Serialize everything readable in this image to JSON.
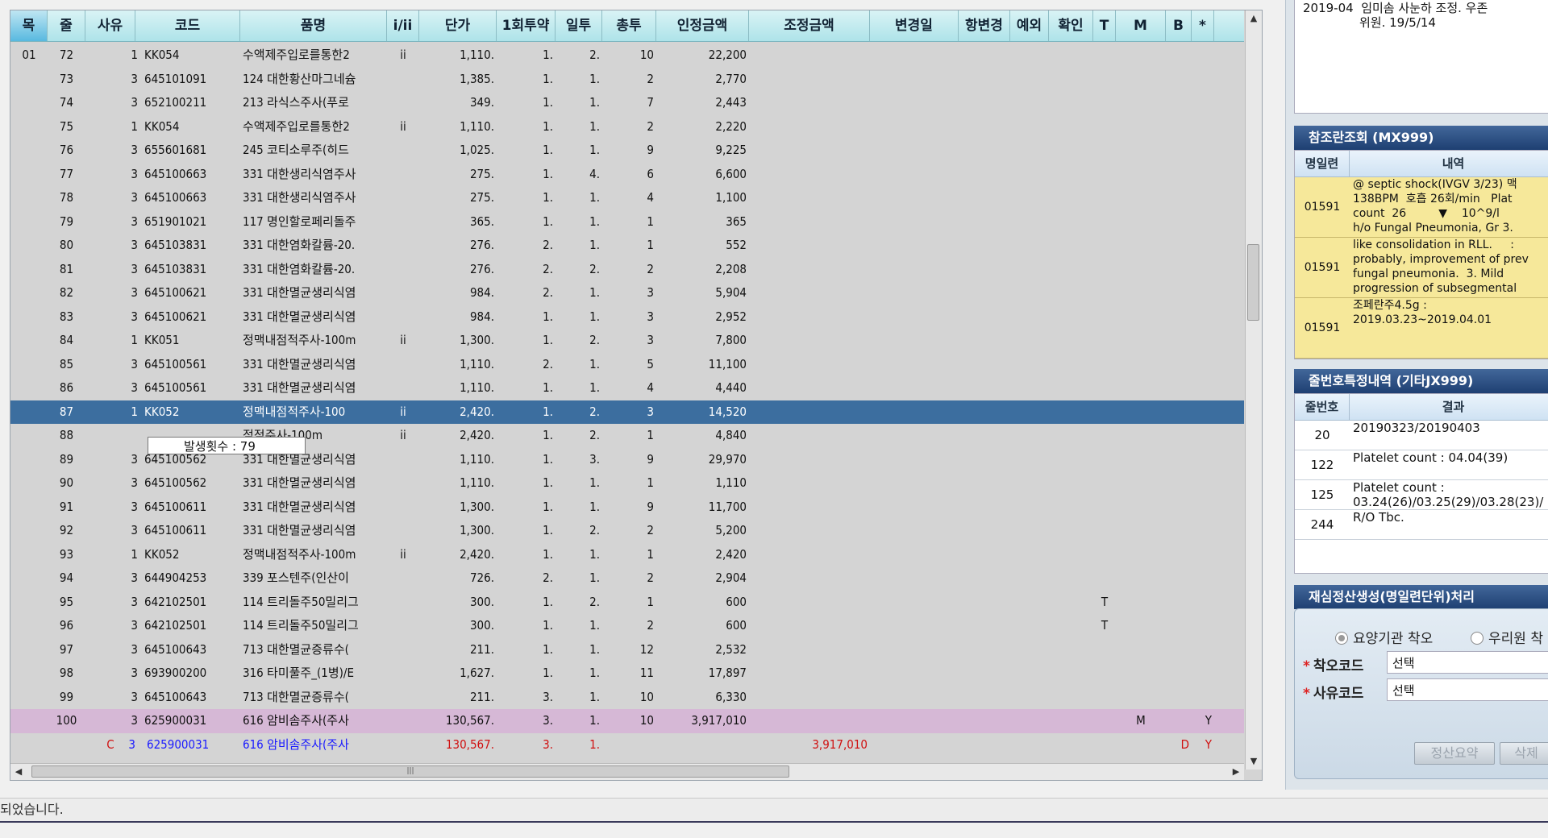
{
  "grid": {
    "columns": [
      {
        "key": "a",
        "label": "목",
        "w": 46
      },
      {
        "key": "b",
        "label": "줄",
        "w": 47
      },
      {
        "key": "c",
        "label": "사유",
        "w": 62
      },
      {
        "key": "d",
        "label": "코드",
        "w": 130
      },
      {
        "key": "e",
        "label": "품명",
        "w": 182
      },
      {
        "key": "f",
        "label": "i/ii",
        "w": 40
      },
      {
        "key": "g",
        "label": "단가",
        "w": 96
      },
      {
        "key": "h",
        "label": "1회투약",
        "w": 73
      },
      {
        "key": "i",
        "label": "일투",
        "w": 58
      },
      {
        "key": "j",
        "label": "총투",
        "w": 67
      },
      {
        "key": "k",
        "label": "인정금액",
        "w": 115
      },
      {
        "key": "l",
        "label": "조정금액",
        "w": 150
      },
      {
        "key": "m",
        "label": "변경일",
        "w": 110
      },
      {
        "key": "n",
        "label": "항변경",
        "w": 64
      },
      {
        "key": "o",
        "label": "예외",
        "w": 48
      },
      {
        "key": "p",
        "label": "확인",
        "w": 55
      },
      {
        "key": "q",
        "label": "T",
        "w": 28
      },
      {
        "key": "r",
        "label": "M",
        "w": 62
      },
      {
        "key": "s",
        "label": "B",
        "w": 32
      },
      {
        "key": "t",
        "label": "*",
        "w": 28
      }
    ],
    "rows": [
      {
        "a": "01",
        "b": "72",
        "c": "",
        "sub": "1",
        "d": "KK054",
        "e": "수액제주입로를통한2",
        "f": "ii",
        "g": "1,110.",
        "h": "1.",
        "i": "2.",
        "j": "10",
        "k": "22,200",
        "style": ""
      },
      {
        "a": "",
        "b": "73",
        "c": "",
        "sub": "3",
        "d": "645101091",
        "e": "124 대한황산마그네슘",
        "f": "",
        "g": "1,385.",
        "h": "1.",
        "i": "1.",
        "j": "2",
        "k": "2,770",
        "style": ""
      },
      {
        "a": "",
        "b": "74",
        "c": "",
        "sub": "3",
        "d": "652100211",
        "e": "213 라식스주사(푸로",
        "f": "",
        "g": "349.",
        "h": "1.",
        "i": "1.",
        "j": "7",
        "k": "2,443",
        "style": ""
      },
      {
        "a": "",
        "b": "75",
        "c": "",
        "sub": "1",
        "d": "KK054",
        "e": "수액제주입로를통한2",
        "f": "ii",
        "g": "1,110.",
        "h": "1.",
        "i": "1.",
        "j": "2",
        "k": "2,220",
        "style": ""
      },
      {
        "a": "",
        "b": "76",
        "c": "",
        "sub": "3",
        "d": "655601681",
        "e": "245 코티소루주(히드",
        "f": "",
        "g": "1,025.",
        "h": "1.",
        "i": "1.",
        "j": "9",
        "k": "9,225",
        "style": ""
      },
      {
        "a": "",
        "b": "77",
        "c": "",
        "sub": "3",
        "d": "645100663",
        "e": "331 대한생리식염주사",
        "f": "",
        "g": "275.",
        "h": "1.",
        "i": "4.",
        "j": "6",
        "k": "6,600",
        "style": ""
      },
      {
        "a": "",
        "b": "78",
        "c": "",
        "sub": "3",
        "d": "645100663",
        "e": "331 대한생리식염주사",
        "f": "",
        "g": "275.",
        "h": "1.",
        "i": "1.",
        "j": "4",
        "k": "1,100",
        "style": ""
      },
      {
        "a": "",
        "b": "79",
        "c": "",
        "sub": "3",
        "d": "651901021",
        "e": "117 명인할로페리돌주",
        "f": "",
        "g": "365.",
        "h": "1.",
        "i": "1.",
        "j": "1",
        "k": "365",
        "style": ""
      },
      {
        "a": "",
        "b": "80",
        "c": "",
        "sub": "3",
        "d": "645103831",
        "e": "331 대한염화칼륨-20.",
        "f": "",
        "g": "276.",
        "h": "2.",
        "i": "1.",
        "j": "1",
        "k": "552",
        "style": ""
      },
      {
        "a": "",
        "b": "81",
        "c": "",
        "sub": "3",
        "d": "645103831",
        "e": "331 대한염화칼륨-20.",
        "f": "",
        "g": "276.",
        "h": "2.",
        "i": "2.",
        "j": "2",
        "k": "2,208",
        "style": ""
      },
      {
        "a": "",
        "b": "82",
        "c": "",
        "sub": "3",
        "d": "645100621",
        "e": "331 대한멸균생리식염",
        "f": "",
        "g": "984.",
        "h": "2.",
        "i": "1.",
        "j": "3",
        "k": "5,904",
        "style": ""
      },
      {
        "a": "",
        "b": "83",
        "c": "",
        "sub": "3",
        "d": "645100621",
        "e": "331 대한멸균생리식염",
        "f": "",
        "g": "984.",
        "h": "1.",
        "i": "1.",
        "j": "3",
        "k": "2,952",
        "style": ""
      },
      {
        "a": "",
        "b": "84",
        "c": "",
        "sub": "1",
        "d": "KK051",
        "e": "정맥내점적주사-100m",
        "f": "ii",
        "g": "1,300.",
        "h": "1.",
        "i": "2.",
        "j": "3",
        "k": "7,800",
        "style": ""
      },
      {
        "a": "",
        "b": "85",
        "c": "",
        "sub": "3",
        "d": "645100561",
        "e": "331 대한멸균생리식염",
        "f": "",
        "g": "1,110.",
        "h": "2.",
        "i": "1.",
        "j": "5",
        "k": "11,100",
        "style": ""
      },
      {
        "a": "",
        "b": "86",
        "c": "",
        "sub": "3",
        "d": "645100561",
        "e": "331 대한멸균생리식염",
        "f": "",
        "g": "1,110.",
        "h": "1.",
        "i": "1.",
        "j": "4",
        "k": "4,440",
        "style": ""
      },
      {
        "a": "",
        "b": "87",
        "c": "",
        "sub": "1",
        "d": "KK052",
        "e": "정맥내점적주사-100",
        "f": "ii",
        "g": "2,420.",
        "h": "1.",
        "i": "2.",
        "j": "3",
        "k": "14,520",
        "style": "selected"
      },
      {
        "a": "",
        "b": "88",
        "c": "",
        "sub": "",
        "d": "",
        "e": "점적주사-100m",
        "f": "ii",
        "g": "2,420.",
        "h": "1.",
        "i": "2.",
        "j": "1",
        "k": "4,840",
        "style": ""
      },
      {
        "a": "",
        "b": "89",
        "c": "",
        "sub": "3",
        "d": "645100562",
        "e": "331 대한멸균생리식염",
        "f": "",
        "g": "1,110.",
        "h": "1.",
        "i": "3.",
        "j": "9",
        "k": "29,970",
        "style": ""
      },
      {
        "a": "",
        "b": "90",
        "c": "",
        "sub": "3",
        "d": "645100562",
        "e": "331 대한멸균생리식염",
        "f": "",
        "g": "1,110.",
        "h": "1.",
        "i": "1.",
        "j": "1",
        "k": "1,110",
        "style": ""
      },
      {
        "a": "",
        "b": "91",
        "c": "",
        "sub": "3",
        "d": "645100611",
        "e": "331 대한멸균생리식염",
        "f": "",
        "g": "1,300.",
        "h": "1.",
        "i": "1.",
        "j": "9",
        "k": "11,700",
        "style": ""
      },
      {
        "a": "",
        "b": "92",
        "c": "",
        "sub": "3",
        "d": "645100611",
        "e": "331 대한멸균생리식염",
        "f": "",
        "g": "1,300.",
        "h": "1.",
        "i": "2.",
        "j": "2",
        "k": "5,200",
        "style": ""
      },
      {
        "a": "",
        "b": "93",
        "c": "",
        "sub": "1",
        "d": "KK052",
        "e": "정맥내점적주사-100m",
        "f": "ii",
        "g": "2,420.",
        "h": "1.",
        "i": "1.",
        "j": "1",
        "k": "2,420",
        "style": ""
      },
      {
        "a": "",
        "b": "94",
        "c": "",
        "sub": "3",
        "d": "644904253",
        "e": "339 포스텐주(인산이",
        "f": "",
        "g": "726.",
        "h": "2.",
        "i": "1.",
        "j": "2",
        "k": "2,904",
        "style": ""
      },
      {
        "a": "",
        "b": "95",
        "c": "",
        "sub": "3",
        "d": "642102501",
        "e": "114 트리돌주50밀리그",
        "f": "",
        "g": "300.",
        "h": "1.",
        "i": "2.",
        "j": "1",
        "k": "600",
        "q": "T",
        "style": ""
      },
      {
        "a": "",
        "b": "96",
        "c": "",
        "sub": "3",
        "d": "642102501",
        "e": "114 트리돌주50밀리그",
        "f": "",
        "g": "300.",
        "h": "1.",
        "i": "1.",
        "j": "2",
        "k": "600",
        "q": "T",
        "style": ""
      },
      {
        "a": "",
        "b": "97",
        "c": "",
        "sub": "3",
        "d": "645100643",
        "e": "713 대한멸균증류수(",
        "f": "",
        "g": "211.",
        "h": "1.",
        "i": "1.",
        "j": "12",
        "k": "2,532",
        "style": ""
      },
      {
        "a": "",
        "b": "98",
        "c": "",
        "sub": "3",
        "d": "693900200",
        "e": "316 타미풀주_(1병)/E",
        "f": "",
        "g": "1,627.",
        "h": "1.",
        "i": "1.",
        "j": "11",
        "k": "17,897",
        "style": ""
      },
      {
        "a": "",
        "b": "99",
        "c": "",
        "sub": "3",
        "d": "645100643",
        "e": "713 대한멸균증류수(",
        "f": "",
        "g": "211.",
        "h": "3.",
        "i": "1.",
        "j": "10",
        "k": "6,330",
        "style": ""
      },
      {
        "a": "",
        "b": "100",
        "c": "",
        "sub": "3",
        "d": "625900031",
        "e": "616 암비솜주사(주사",
        "f": "",
        "g": "130,567.",
        "h": "3.",
        "i": "1.",
        "j": "10",
        "k": "3,917,010",
        "r": "M",
        "t": "Y",
        "style": "pink"
      },
      {
        "a": "",
        "b": "",
        "c": "C",
        "sub": "3",
        "d": "625900031",
        "e": "616 암비솜주사(주사",
        "f": "",
        "g": "130,567.",
        "h": "3.",
        "i": "1.",
        "j": "",
        "k": "",
        "l": "3,917,010",
        "s": "D",
        "t": "Y",
        "style": "red"
      }
    ],
    "tooltip": "발생횟수 : 79"
  },
  "right_panel": {
    "top_note": {
      "line1": "2019-04  임미솜 사눈하 조정. 우존",
      "line2": "위원. 19/5/14"
    },
    "ref_section": {
      "title": "참조란조회 (MX999)",
      "col1": "명일련",
      "col2": "내역",
      "rows": [
        {
          "id": "01591",
          "text": "@ septic shock(IVGV 3/23) 맥\n138BPM  호흡 26회/min   Plat\ncount  26         ▼    10^9/l\nh/o Fungal Pneumonia, Gr 3."
        },
        {
          "id": "01591",
          "text": "like consolidation in RLL.     :\nprobably, improvement of prev\nfungal pneumonia.  3. Mild\nprogression of subsegmental"
        },
        {
          "id": "01591",
          "text": "조페란주4.5g :\n2019.03.23~2019.04.01"
        }
      ]
    },
    "line_section": {
      "title": "줄번호특정내역 (기타JX999)",
      "col1": "줄번호",
      "col2": "결과",
      "rows": [
        {
          "id": "20",
          "text": "20190323/20190403"
        },
        {
          "id": "122",
          "text": "Platelet count : 04.04(39)"
        },
        {
          "id": "125",
          "text": "Platelet count :\n03.24(26)/03.25(29)/03.28(23)/"
        },
        {
          "id": "244",
          "text": "R/O Tbc."
        }
      ]
    },
    "recalc_section": {
      "title": "재심정산생성(명일련단위)처리",
      "radio1": "요양기관 착오",
      "radio2": "우리원 착",
      "err_code_label": "착오코드",
      "err_code_value": "선택",
      "reason_code_label": "사유코드",
      "reason_code_value": "선택",
      "btn_summary": "정산요약",
      "btn_delete": "삭제"
    }
  },
  "status_bar": {
    "message": "되었습니다."
  }
}
